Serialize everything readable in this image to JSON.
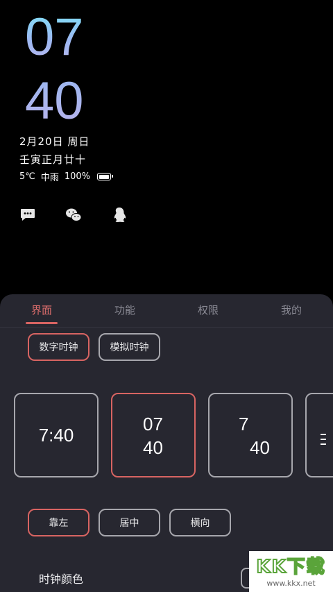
{
  "lockscreen": {
    "hour": "07",
    "minute": "40",
    "date": "2月20日 周日",
    "lunar": "壬寅正月廿十",
    "temperature": "5℃",
    "weather": "中雨",
    "battery": "100%",
    "battery_level": 1.0,
    "notification_icons": [
      "message-icon",
      "wechat-icon",
      "qq-icon"
    ]
  },
  "tabs": [
    {
      "label": "界面",
      "active": true
    },
    {
      "label": "功能",
      "active": false
    },
    {
      "label": "权限",
      "active": false
    },
    {
      "label": "我的",
      "active": false
    }
  ],
  "clock_type": {
    "digital": "数字时钟",
    "analog": "模拟时钟",
    "selected": "digital"
  },
  "clock_styles": [
    {
      "line1": "7:40",
      "selected": false
    },
    {
      "line1": "07",
      "line2": "40",
      "selected": true
    },
    {
      "line1": "7",
      "line2": "40",
      "selected": false
    }
  ],
  "alignment": {
    "left": "靠左",
    "center": "居中",
    "horizontal": "横向",
    "selected": "left"
  },
  "clock_color": {
    "title": "时钟颜色"
  },
  "watermark": {
    "logo": "KK下载",
    "url": "www.kkx.net"
  }
}
